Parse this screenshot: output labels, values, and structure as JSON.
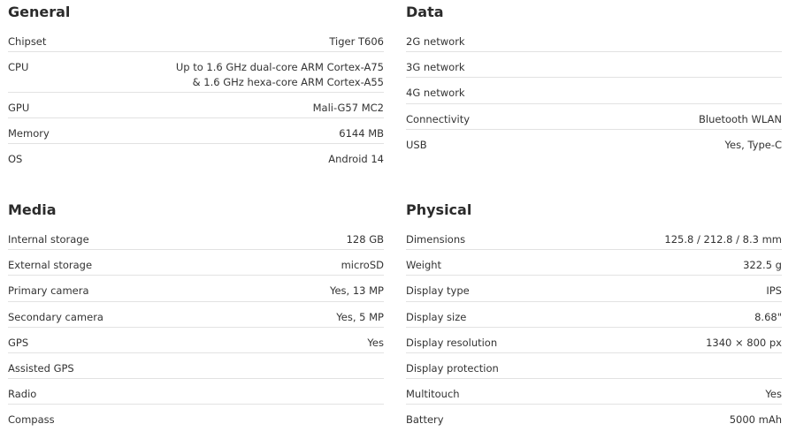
{
  "general": {
    "title": "General",
    "rows": [
      {
        "label": "Chipset",
        "value": "Tiger T606"
      },
      {
        "label": "CPU",
        "value": "Up to 1.6 GHz dual-core ARM Cortex-A75 & 1.6 GHz hexa-core ARM Cortex-A55"
      },
      {
        "label": "GPU",
        "value": "Mali-G57 MC2"
      },
      {
        "label": "Memory",
        "value": "6144 MB"
      },
      {
        "label": "OS",
        "value": "Android 14"
      }
    ]
  },
  "data": {
    "title": "Data",
    "rows": [
      {
        "label": "2G network",
        "value": ""
      },
      {
        "label": "3G network",
        "value": ""
      },
      {
        "label": "4G network",
        "value": ""
      },
      {
        "label": "Connectivity",
        "value": "Bluetooth WLAN"
      },
      {
        "label": "USB",
        "value": "Yes, Type-C"
      }
    ]
  },
  "media": {
    "title": "Media",
    "rows": [
      {
        "label": "Internal storage",
        "value": "128 GB"
      },
      {
        "label": "External storage",
        "value": "microSD"
      },
      {
        "label": "Primary camera",
        "value": "Yes, 13 MP"
      },
      {
        "label": "Secondary camera",
        "value": "Yes, 5 MP"
      },
      {
        "label": "GPS",
        "value": "Yes"
      },
      {
        "label": "Assisted GPS",
        "value": ""
      },
      {
        "label": "Radio",
        "value": ""
      },
      {
        "label": "Compass",
        "value": ""
      }
    ]
  },
  "physical": {
    "title": "Physical",
    "rows": [
      {
        "label": "Dimensions",
        "value": "125.8 / 212.8 / 8.3 mm"
      },
      {
        "label": "Weight",
        "value": "322.5 g"
      },
      {
        "label": "Display type",
        "value": "IPS"
      },
      {
        "label": "Display size",
        "value": "8.68\""
      },
      {
        "label": "Display resolution",
        "value": "1340 × 800 px"
      },
      {
        "label": "Display protection",
        "value": ""
      },
      {
        "label": "Multitouch",
        "value": "Yes"
      },
      {
        "label": "Battery",
        "value": "5000 mAh"
      }
    ]
  }
}
